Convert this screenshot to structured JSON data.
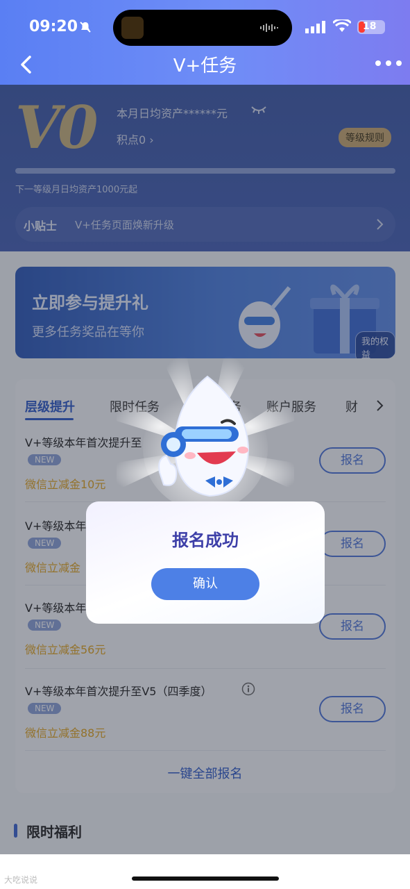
{
  "status_bar": {
    "time": "09:20",
    "battery": "18"
  },
  "nav": {
    "title": "V+任务"
  },
  "header": {
    "level": "V0",
    "asset_text": "本月日均资产******元",
    "points_text": "积点0",
    "rule_button": "等级规则",
    "next_level_text": "下一等级月日均资产1000元起",
    "tip_title": "小贴士",
    "tip_text": "V+任务页面焕新升级"
  },
  "banner": {
    "title": "立即参与提升礼",
    "subtitle": "更多任务奖品在等你",
    "rights_button": "我的权益"
  },
  "tabs": [
    {
      "label": "层级提升"
    },
    {
      "label": "限时任务"
    },
    {
      "label": "任务"
    },
    {
      "label": "账户服务"
    },
    {
      "label": "财"
    }
  ],
  "tasks": [
    {
      "title": "V+等级本年首次提升至",
      "badge": "NEW",
      "reward": "微信立减金10元",
      "button": "报名"
    },
    {
      "title": "V+等级本年",
      "badge": "NEW",
      "reward": "微信立减金",
      "button": "报名"
    },
    {
      "title": "V+等级本年",
      "badge": "NEW",
      "reward": "微信立减金56元",
      "button": "报名"
    },
    {
      "title": "V+等级本年首次提升至V5（四季度）",
      "badge": "NEW",
      "reward": "微信立减金88元",
      "button": "报名"
    }
  ],
  "signup_all": "一键全部报名",
  "section": {
    "title": "限时福利"
  },
  "modal": {
    "title": "报名成功",
    "confirm": "确认"
  },
  "watermark": "大吃说说"
}
